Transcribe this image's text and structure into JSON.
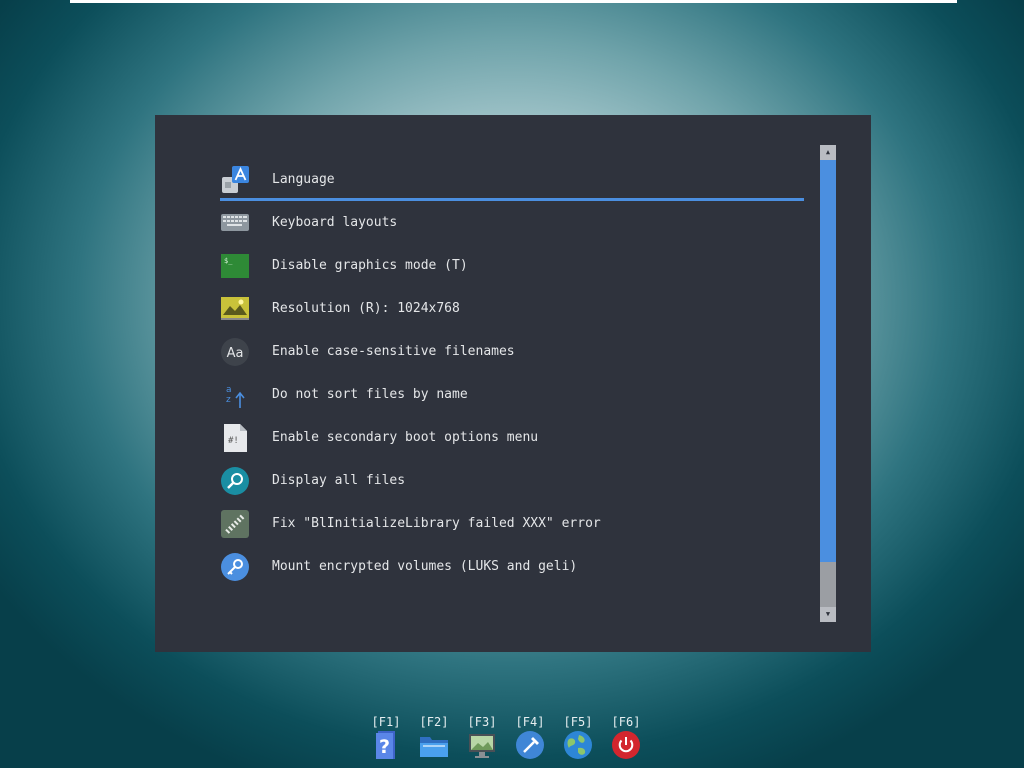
{
  "main": {
    "menu": {
      "selected_index": 0,
      "items": [
        {
          "label": "Language",
          "icon": "language-icon"
        },
        {
          "label": "Keyboard layouts",
          "icon": "keyboard-icon"
        },
        {
          "label": "Disable graphics mode (T)",
          "icon": "terminal-icon"
        },
        {
          "label": "Resolution (R): 1024x768",
          "icon": "display-resolution-icon"
        },
        {
          "label": "Enable case-sensitive filenames",
          "icon": "font-case-icon"
        },
        {
          "label": "Do not sort files by name",
          "icon": "sort-alpha-icon"
        },
        {
          "label": "Enable secondary boot options menu",
          "icon": "script-file-icon"
        },
        {
          "label": "Display all files",
          "icon": "search-icon"
        },
        {
          "label": "Fix \"BlInitializeLibrary failed XXX\" error",
          "icon": "memory-chip-icon"
        },
        {
          "label": "Mount encrypted volumes (LUKS and geli)",
          "icon": "key-icon"
        }
      ]
    },
    "scrollbar": {
      "up_arrow": "▲",
      "down_arrow": "▼",
      "visible_fraction": 0.9
    }
  },
  "footer": {
    "keys": [
      {
        "key": "[F1]",
        "icon": "help-icon"
      },
      {
        "key": "[F2]",
        "icon": "folder-icon"
      },
      {
        "key": "[F3]",
        "icon": "display-settings-icon"
      },
      {
        "key": "[F4]",
        "icon": "tools-icon"
      },
      {
        "key": "[F5]",
        "icon": "globe-icon"
      },
      {
        "key": "[F6]",
        "icon": "power-icon"
      }
    ]
  },
  "colors": {
    "accent": "#4b8fe0",
    "panel": "#2f333d",
    "power": "#d3262e"
  }
}
